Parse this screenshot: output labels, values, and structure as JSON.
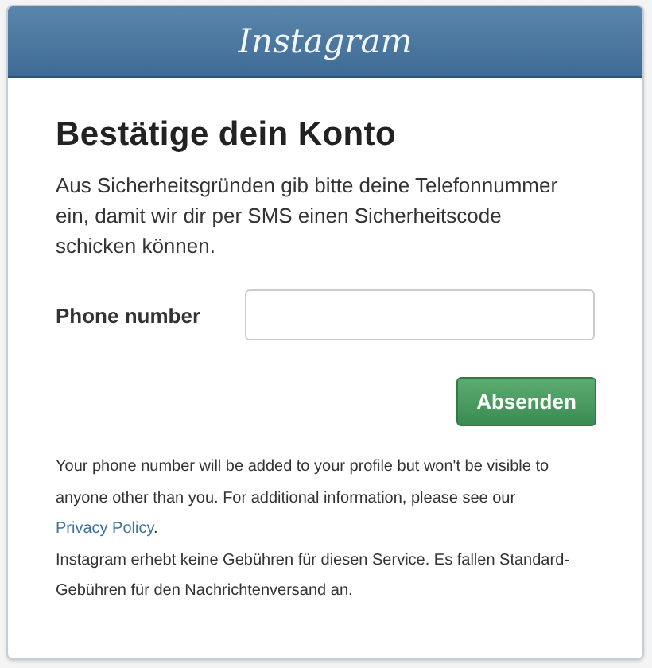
{
  "header": {
    "logo": "Instagram"
  },
  "title": "Bestätige dein Konto",
  "intro": "Aus Sicherheitsgründen gib bitte deine Telefonnummer ein, damit wir dir per SMS einen Sicherheitscode schicken können.",
  "form": {
    "label": "Phone number",
    "submit": "Absenden"
  },
  "notice": {
    "text": "Your phone number will be added to your profile but won't be visible to anyone other than you. For additional information, please see our ",
    "link": "Privacy Policy",
    "after": "."
  },
  "fees": "Instagram erhebt keine Gebühren für diesen Service. Es fallen Standard-Gebühren für den Nachrichtenversand an."
}
